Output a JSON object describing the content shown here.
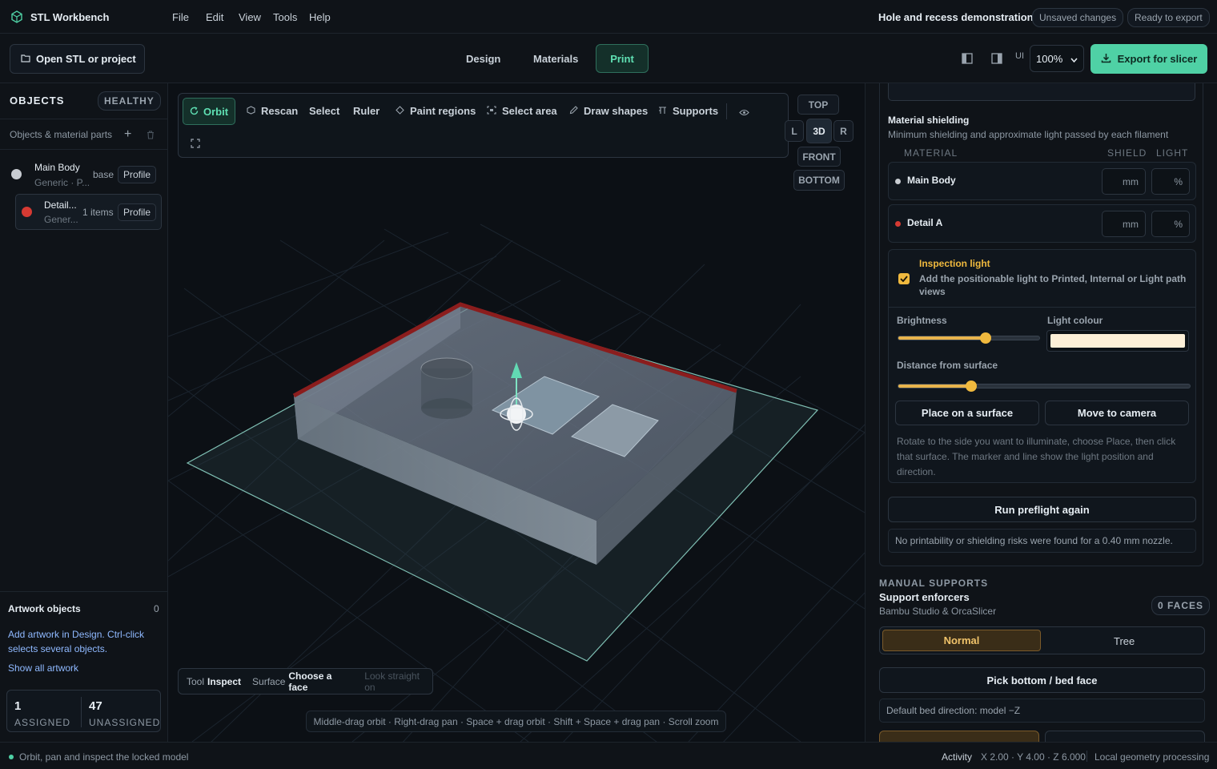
{
  "app": {
    "title": "STL Workbench",
    "menu": [
      "File",
      "Edit",
      "View",
      "Tools",
      "Help"
    ],
    "filename": "Hole and recess demonstration.stl",
    "badge_unsaved": "Unsaved changes",
    "badge_ready": "Ready to export"
  },
  "toolbar": {
    "open_label": "Open STL or project",
    "tabs": [
      "Design",
      "Materials",
      "Print"
    ],
    "active_tab": "Print",
    "ui_label": "UI",
    "zoom": "100%",
    "export_label": "Export for slicer"
  },
  "objects": {
    "title": "OBJECTS",
    "status": "HEALTHY",
    "subtitle": "Objects & material parts",
    "items": [
      {
        "name": "Main Body",
        "detail": "Generic · P...",
        "tag": "base",
        "profile": "Profile",
        "color": "#c8ccd2"
      },
      {
        "name": "Detail...",
        "detail": "Gener...",
        "tag": "1 items",
        "profile": "Profile",
        "color": "#d63a33"
      }
    ],
    "artwork_title": "Artwork objects",
    "artwork_count": "0",
    "artwork_help": "Add artwork in Design. Ctrl-click selects several objects.",
    "show_all": "Show all artwork",
    "assigned_n": "1",
    "assigned_l": "ASSIGNED",
    "unassigned_n": "47",
    "unassigned_l": "UNASSIGNED"
  },
  "viewport": {
    "tools": [
      "Orbit",
      "Rescan",
      "Select",
      "Ruler",
      "Paint regions",
      "Select area",
      "Draw shapes",
      "Supports"
    ],
    "views": {
      "top": "TOP",
      "left": "L",
      "center": "3D",
      "right": "R",
      "front": "FRONT",
      "bottom": "BOTTOM"
    },
    "info": {
      "tool_k": "Tool",
      "tool_v": "Inspect",
      "surface_k": "Surface",
      "surface_v": "Choose a face",
      "look": "Look straight on"
    },
    "hint": "Middle-drag orbit · Right-drag pan · Space + drag orbit · Shift + Space + drag pan · Scroll zoom"
  },
  "shielding": {
    "title": "Material shielding",
    "subtitle": "Minimum shielding and approximate light passed by each filament",
    "col_material": "MATERIAL",
    "col_shield": "SHIELD",
    "col_light": "LIGHT",
    "rows": [
      {
        "name": "Main Body",
        "color": "#c8ccd2",
        "unit_shield": "mm",
        "unit_light": "%"
      },
      {
        "name": "Detail A",
        "color": "#d63a33",
        "unit_shield": "mm",
        "unit_light": "%"
      }
    ]
  },
  "inspection": {
    "title": "Inspection light",
    "desc": "Add the positionable light to Printed, Internal or Light path views",
    "brightness_label": "Brightness",
    "brightness": 0.62,
    "colour_label": "Light colour",
    "colour": "#fdf0d8",
    "distance_label": "Distance from surface",
    "distance": 0.25,
    "place": "Place on a surface",
    "camera": "Move to camera",
    "help": "Rotate to the side you want to illuminate, choose Place, then click that surface. The marker and line show the light position and direction."
  },
  "preflight": {
    "run": "Run preflight again",
    "result": "No printability or shielding risks were found for a 0.40 mm nozzle."
  },
  "supports": {
    "section": "MANUAL SUPPORTS",
    "title": "Support enforcers",
    "subtitle": "Bambu Studio & OrcaSlicer",
    "faces": "0 FACES",
    "mode_normal": "Normal",
    "mode_tree": "Tree",
    "pick": "Pick bottom / bed face",
    "bed_direction": "Default bed direction: model −Z"
  },
  "status": {
    "left": "Orbit, pan and inspect the locked model",
    "activity": "Activity",
    "coords": "X 2.00 · Y 4.00 · Z 6.000",
    "processing": "Local geometry processing"
  },
  "colors": {
    "accent": "#4fd1a5",
    "warning": "#f0b93e",
    "detail": "#d63a33"
  }
}
